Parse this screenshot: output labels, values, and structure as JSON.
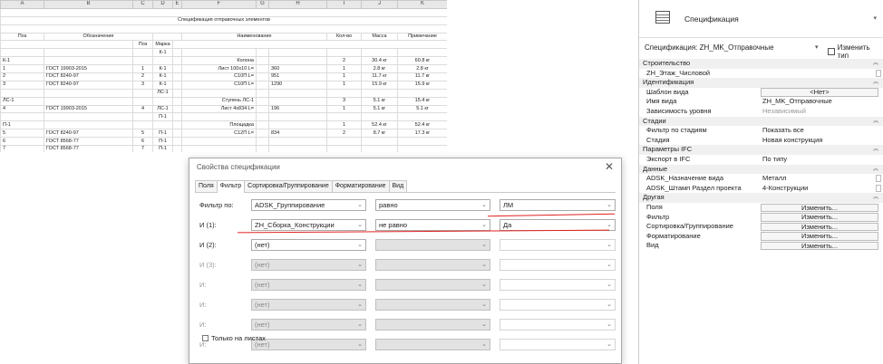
{
  "sheet": {
    "columns": [
      "A",
      "B",
      "C",
      "D",
      "E",
      "F",
      "G",
      "H",
      "I",
      "J",
      "K"
    ],
    "title": "Спецификация отправочных элементов",
    "headers": {
      "pos": "Поз",
      "designation": "Обозначение",
      "pos2": "Поз",
      "mark": "Марка",
      "name": "Наименование",
      "qty": "Кол-во",
      "mass": "Масса",
      "note": "Примечание"
    },
    "rows": [
      {
        "a": "",
        "b": "",
        "c": "",
        "d": "К-1",
        "f": "",
        "h": "",
        "i": "",
        "j": "",
        "k": ""
      },
      {
        "a": "К-1",
        "b": "",
        "c": "",
        "d": "",
        "f": "Колона",
        "h": "",
        "i": "2",
        "j": "30.4 кг",
        "k": "60.8 кг"
      },
      {
        "a": "1",
        "b": "ГОСТ 19903-2015",
        "c": "1",
        "d": "К-1",
        "f": "Лист 100х10  L=",
        "h": "360",
        "i": "1",
        "j": "2.8 кг",
        "k": "2.8 кг"
      },
      {
        "a": "2",
        "b": "ГОСТ 8240-97",
        "c": "2",
        "d": "К-1",
        "f": "C10П  L=",
        "h": "951",
        "i": "1",
        "j": "11.7 кг",
        "k": "11.7 кг"
      },
      {
        "a": "3",
        "b": "ГОСТ 8240-97",
        "c": "3",
        "d": "К-1",
        "f": "C10П  L=",
        "h": "1290",
        "i": "1",
        "j": "15.9 кг",
        "k": "15.9 кг"
      },
      {
        "a": "",
        "b": "",
        "c": "",
        "d": "ЛС-1",
        "f": "",
        "h": "",
        "i": "",
        "j": "",
        "k": ""
      },
      {
        "a": "ЛС-1",
        "b": "",
        "c": "",
        "d": "",
        "f": "Ступень ЛС-1",
        "h": "",
        "i": "3",
        "j": "5.1 кг",
        "k": "15.4 кг"
      },
      {
        "a": "4",
        "b": "ГОСТ 19903-2015",
        "c": "4",
        "d": "ЛС-1",
        "f": "Лист 4х834  L=",
        "h": "196",
        "i": "1",
        "j": "5.1 кг",
        "k": "5.1 кг"
      },
      {
        "a": "",
        "b": "",
        "c": "",
        "d": "П-1",
        "f": "",
        "h": "",
        "i": "",
        "j": "",
        "k": ""
      },
      {
        "a": "П-1",
        "b": "",
        "c": "",
        "d": "",
        "f": "Площадка",
        "h": "",
        "i": "1",
        "j": "52.4 кг",
        "k": "52.4 кг"
      },
      {
        "a": "5",
        "b": "ГОСТ 8240-97",
        "c": "5",
        "d": "П-1",
        "f": "C12П  L=",
        "h": "834",
        "i": "2",
        "j": "8.7 кг",
        "k": "17.3 кг"
      },
      {
        "a": "6",
        "b": "ГОСТ 8568-77",
        "c": "6",
        "d": "П-1",
        "f": "",
        "h": "",
        "i": "",
        "j": "",
        "k": ""
      },
      {
        "a": "7",
        "b": "ГОСТ 8568-77",
        "c": "7",
        "d": "П-1",
        "f": "",
        "h": "",
        "i": "",
        "j": "",
        "k": ""
      }
    ]
  },
  "dialog": {
    "title": "Свойства спецификации",
    "close": "✕",
    "tabs": [
      "Поля",
      "Фильтр",
      "Сортировка/Группирование",
      "Форматирование",
      "Вид"
    ],
    "filters": [
      {
        "label": "Фильтр по:",
        "field": "ADSK_Группирование",
        "op": "равно",
        "value": "ЛМ"
      },
      {
        "label": "И (1):",
        "field": "ZH_Сборка_Конструкции",
        "op": "не равно",
        "value": "Да"
      },
      {
        "label": "И (2):",
        "field": "(нет)",
        "op": "",
        "value": ""
      },
      {
        "label": "И (3):",
        "field": "(нет)",
        "op": "",
        "value": ""
      },
      {
        "label": "И:",
        "field": "(нет)",
        "op": "",
        "value": ""
      },
      {
        "label": "И:",
        "field": "(нет)",
        "op": "",
        "value": ""
      },
      {
        "label": "И:",
        "field": "(нет)",
        "op": "",
        "value": ""
      },
      {
        "label": "И:",
        "field": "(нет)",
        "op": "",
        "value": ""
      }
    ],
    "only_on_sheets": "Только на листах"
  },
  "props": {
    "type_name": "Спецификация",
    "selector": "Спецификация: ZH_MK_Отправочные",
    "edit_type": "Изменить тип",
    "rows": [
      {
        "kind": "cat",
        "name": "Строительство"
      },
      {
        "kind": "chk",
        "name": "ZH_Этаж_Числовой"
      },
      {
        "kind": "cat",
        "name": "Идентификация"
      },
      {
        "kind": "btn",
        "name": "Шаблон вида",
        "value": "<Нет>"
      },
      {
        "kind": "val",
        "name": "Имя вида",
        "value": "ZH_MK_Отправочные"
      },
      {
        "kind": "grey",
        "name": "Зависимость уровня",
        "value": "Независимый"
      },
      {
        "kind": "cat",
        "name": "Стадии"
      },
      {
        "kind": "val",
        "name": "Фильтр по стадиям",
        "value": "Показать все"
      },
      {
        "kind": "val",
        "name": "Стадия",
        "value": "Новая конструкция"
      },
      {
        "kind": "cat",
        "name": "Параметры IFC"
      },
      {
        "kind": "val",
        "name": "Экспорт в IFC",
        "value": "По типу"
      },
      {
        "kind": "cat",
        "name": "Данные"
      },
      {
        "kind": "valchk",
        "name": "ADSK_Назначение вида",
        "value": "Металл"
      },
      {
        "kind": "valchk",
        "name": "ADSK_Штамп Раздел проекта",
        "value": "4-Конструкции"
      },
      {
        "kind": "cat",
        "name": "Другая"
      },
      {
        "kind": "btn",
        "name": "Поля",
        "value": "Изменить..."
      },
      {
        "kind": "btn",
        "name": "Фильтр",
        "value": "Изменить..."
      },
      {
        "kind": "btn",
        "name": "Сортировка/Группирование",
        "value": "Изменить..."
      },
      {
        "kind": "btn",
        "name": "Форматирование",
        "value": "Изменить..."
      },
      {
        "kind": "btn",
        "name": "Вид",
        "value": "Изменить..."
      }
    ]
  },
  "colors": {
    "annotation": "#e02020",
    "disabled": "#e2e2e2"
  }
}
